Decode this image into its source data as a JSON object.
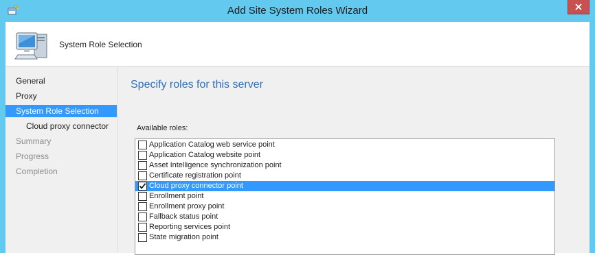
{
  "window": {
    "title": "Add Site System Roles Wizard",
    "close_icon": "close-icon",
    "app_icon": "wizard-app-icon",
    "frame_color": "#63c9ee",
    "close_color": "#c75050"
  },
  "header": {
    "title": "System Role Selection",
    "icon": "computer-icon"
  },
  "sidebar": {
    "items": [
      {
        "label": "General",
        "state": "normal"
      },
      {
        "label": "Proxy",
        "state": "normal"
      },
      {
        "label": "System Role Selection",
        "state": "active"
      },
      {
        "label": "Cloud proxy connector",
        "state": "sub"
      },
      {
        "label": "Summary",
        "state": "disabled"
      },
      {
        "label": "Progress",
        "state": "disabled"
      },
      {
        "label": "Completion",
        "state": "disabled"
      }
    ],
    "active_color": "#3399ff"
  },
  "main": {
    "heading": "Specify roles for this server",
    "heading_color": "#2f6fb5",
    "roles_label": "Available roles:",
    "roles": [
      {
        "label": "Application Catalog web service point",
        "checked": false,
        "selected": false
      },
      {
        "label": "Application Catalog website point",
        "checked": false,
        "selected": false
      },
      {
        "label": "Asset Intelligence synchronization point",
        "checked": false,
        "selected": false
      },
      {
        "label": "Certificate registration point",
        "checked": false,
        "selected": false
      },
      {
        "label": "Cloud proxy connector point",
        "checked": true,
        "selected": true
      },
      {
        "label": "Enrollment point",
        "checked": false,
        "selected": false
      },
      {
        "label": "Enrollment proxy point",
        "checked": false,
        "selected": false
      },
      {
        "label": "Fallback status point",
        "checked": false,
        "selected": false
      },
      {
        "label": "Reporting services point",
        "checked": false,
        "selected": false
      },
      {
        "label": "State migration point",
        "checked": false,
        "selected": false
      }
    ]
  }
}
